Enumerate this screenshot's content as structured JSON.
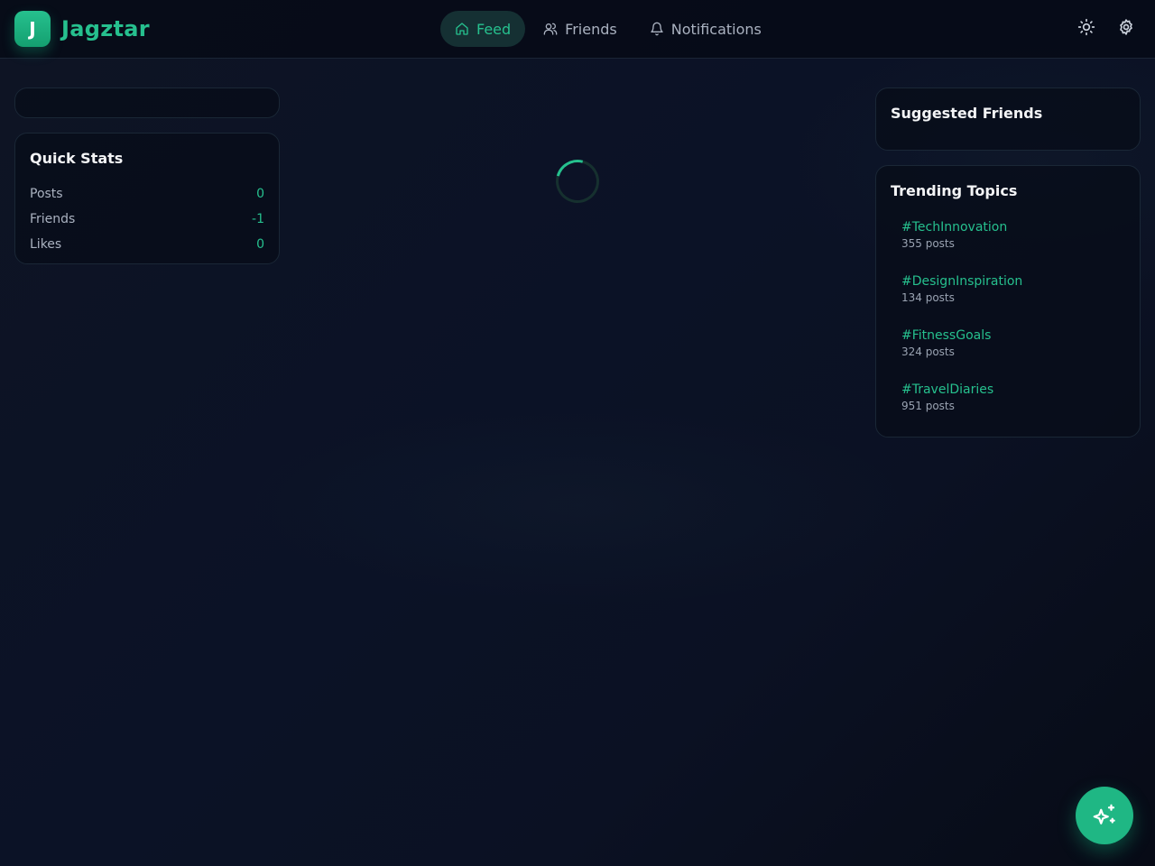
{
  "brand": {
    "logo_letter": "J",
    "name": "Jagztar"
  },
  "nav": {
    "items": [
      {
        "label": "Feed",
        "icon": "home-icon",
        "active": true
      },
      {
        "label": "Friends",
        "icon": "users-icon",
        "active": false
      },
      {
        "label": "Notifications",
        "icon": "bell-icon",
        "active": false
      }
    ]
  },
  "header_actions": [
    "sun-icon",
    "gear-icon"
  ],
  "quick_stats": {
    "title": "Quick Stats",
    "rows": [
      {
        "label": "Posts",
        "value": "0"
      },
      {
        "label": "Friends",
        "value": "-1"
      },
      {
        "label": "Likes",
        "value": "0"
      }
    ]
  },
  "suggested_friends": {
    "title": "Suggested Friends"
  },
  "trending": {
    "title": "Trending Topics",
    "topics": [
      {
        "tag": "#TechInnovation",
        "count": "355 posts"
      },
      {
        "tag": "#DesignInspiration",
        "count": "134 posts"
      },
      {
        "tag": "#FitnessGoals",
        "count": "324 posts"
      },
      {
        "tag": "#TravelDiaries",
        "count": "951 posts"
      }
    ]
  },
  "fab": {
    "icon": "sparkles-icon"
  },
  "colors": {
    "accent": "#26c08e",
    "accent_bg": "#153033",
    "background": "#0b1226",
    "card": "#080d1a"
  }
}
